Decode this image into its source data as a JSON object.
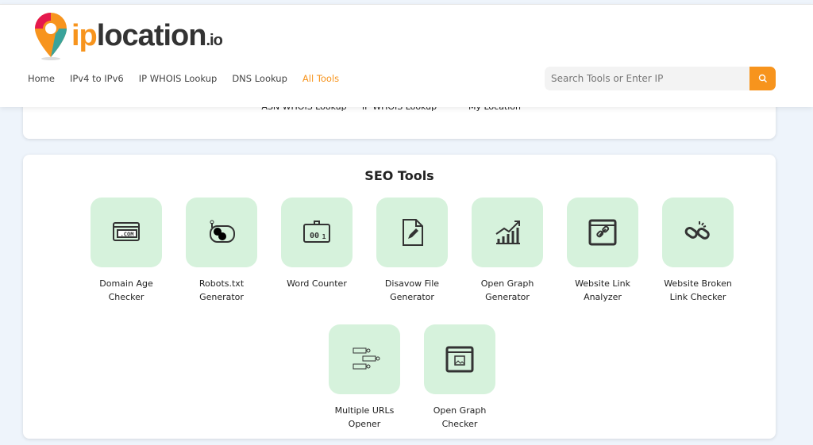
{
  "brand": {
    "logo_ip": "ip",
    "logo_location": "location",
    "logo_io": ".io",
    "colors": {
      "orange": "#f7941d",
      "tile": "#d6f2dc"
    }
  },
  "nav": [
    {
      "label": "Home"
    },
    {
      "label": "IPv4 to IPv6"
    },
    {
      "label": "IP WHOIS Lookup"
    },
    {
      "label": "DNS Lookup"
    },
    {
      "label": "All Tools",
      "active": true
    }
  ],
  "search": {
    "placeholder": "Search Tools or Enter IP",
    "icon": "search-icon"
  },
  "top_card": {
    "items": [
      {
        "label": "ASN WHOIS Lookup"
      },
      {
        "label": "IP WHOIS Lookup"
      },
      {
        "label": "My Location"
      }
    ]
  },
  "seo": {
    "title": "SEO Tools",
    "tools": [
      {
        "label": "Domain Age Checker",
        "icon": "domain-com-icon"
      },
      {
        "label": "Robots.txt Generator",
        "icon": "robot-icon"
      },
      {
        "label": "Word Counter",
        "icon": "counter-icon"
      },
      {
        "label": "Disavow File Generator",
        "icon": "file-edit-icon"
      },
      {
        "label": "Open Graph Generator",
        "icon": "growth-chart-icon"
      },
      {
        "label": "Website Link Analyzer",
        "icon": "browser-link-icon"
      },
      {
        "label": "Website Broken Link Checker",
        "icon": "broken-link-icon"
      },
      {
        "label": "Multiple URLs Opener",
        "icon": "multiple-urls-icon"
      },
      {
        "label": "Open Graph Checker",
        "icon": "browser-image-icon"
      }
    ]
  }
}
